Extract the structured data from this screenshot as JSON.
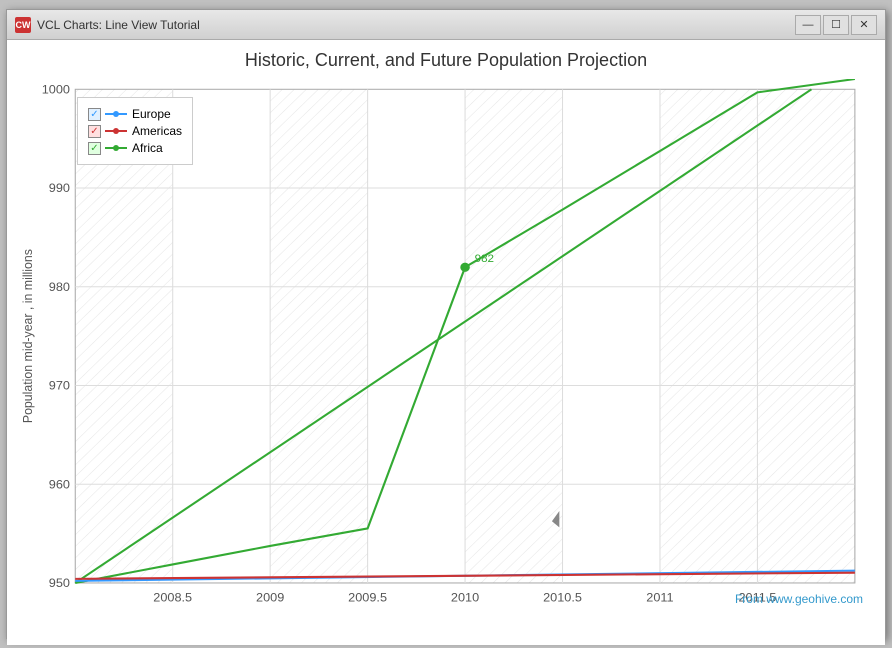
{
  "window": {
    "title": "VCL Charts: Line View Tutorial",
    "icon": "CW",
    "buttons": {
      "minimize": "—",
      "maximize": "☐",
      "close": "✕"
    }
  },
  "chart": {
    "title": "Historic, Current, and Future Population Projection",
    "y_axis_label": "Population mid-year , in millions",
    "y_min": 950,
    "y_max": 1000,
    "y_ticks": [
      950,
      960,
      970,
      980,
      990,
      1000
    ],
    "x_ticks": [
      "2008.5",
      "2009",
      "2009.5",
      "2010",
      "2010.5",
      "2011",
      "2011.5"
    ],
    "watermark": "From www.geohive.com",
    "annotation": {
      "label": "982",
      "x_approx": 0.54,
      "y_approx": 0.37
    },
    "legend": {
      "items": [
        {
          "label": "Europe",
          "color": "#3399ff",
          "checkbox_class": "checked-blue"
        },
        {
          "label": "Americas",
          "color": "#cc3333",
          "checkbox_class": "checked-red"
        },
        {
          "label": "Africa",
          "color": "#33aa33",
          "checkbox_class": "checked-green"
        }
      ]
    }
  }
}
